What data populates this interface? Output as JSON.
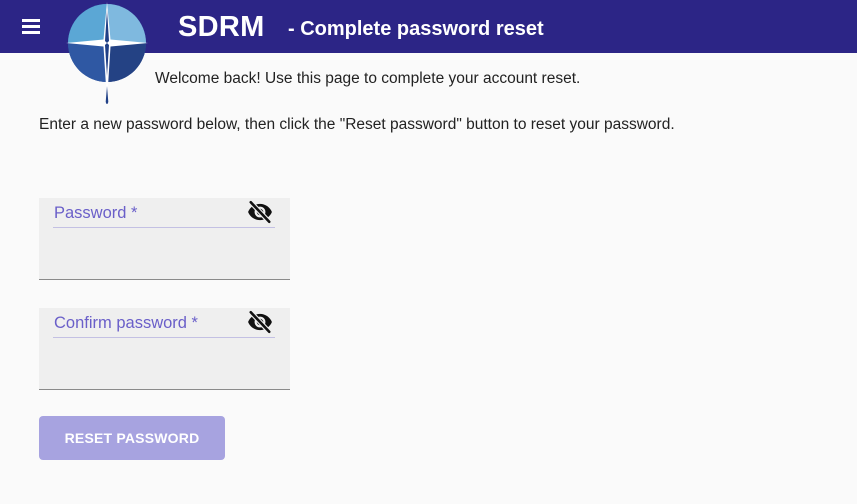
{
  "header": {
    "app_name": "SDRM",
    "page_title": "- Complete password reset",
    "background_color": "#2c2586",
    "menu_icon": "hamburger-menu-icon",
    "logo_icon": "compass-star-logo-icon"
  },
  "main": {
    "welcome_text": "Welcome back! Use this page to complete your account reset.",
    "instructions_text": "Enter a new password below, then click the \"Reset password\" button to reset your password."
  },
  "form": {
    "password": {
      "label": "Password  *",
      "value": "",
      "toggle_icon": "eye-slash-icon"
    },
    "confirm_password": {
      "label": "Confirm password  *",
      "value": "",
      "toggle_icon": "eye-slash-icon"
    },
    "label_color": "#6a5fc9",
    "submit_label": "RESET PASSWORD",
    "submit_color": "#a7a3e0",
    "submit_disabled": true
  }
}
